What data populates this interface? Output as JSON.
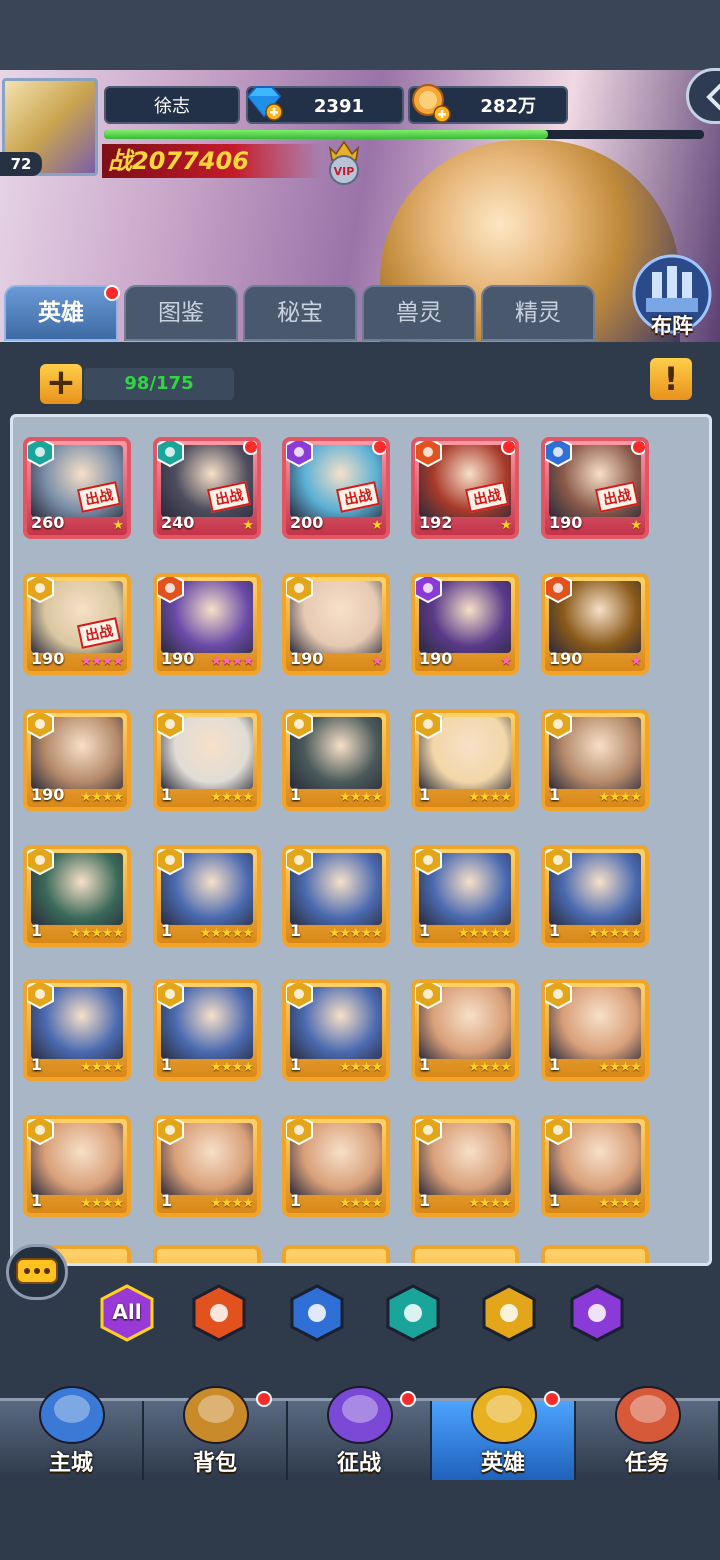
{
  "header": {
    "player_level": "72",
    "player_name": "徐志",
    "gems": "2391",
    "gold": "282万",
    "power": "2077406",
    "power_prefix": "战",
    "vip_label": "VIP",
    "exp_fraction": 0.74
  },
  "tabs": [
    {
      "label": "英雄",
      "active": true,
      "dot": true
    },
    {
      "label": "图鉴",
      "active": false,
      "dot": false
    },
    {
      "label": "秘宝",
      "active": false,
      "dot": false
    },
    {
      "label": "兽灵",
      "active": false,
      "dot": false
    },
    {
      "label": "精灵",
      "active": false,
      "dot": false
    }
  ],
  "formation_label": "布阵",
  "hero_count": "98/175",
  "warn_label": "!",
  "deploy_tag": "出战",
  "heroes": [
    {
      "level": "260",
      "stars": "★",
      "frame": "red",
      "faction": "skull",
      "tag": true,
      "dot": false,
      "portrait": "#7a8fa8"
    },
    {
      "level": "240",
      "stars": "★",
      "frame": "red",
      "faction": "skull",
      "tag": true,
      "dot": true,
      "portrait": "#4d4d5e"
    },
    {
      "level": "200",
      "stars": "★",
      "frame": "red",
      "faction": "trident",
      "tag": true,
      "dot": true,
      "portrait": "#5ab0d6"
    },
    {
      "level": "192",
      "stars": "★",
      "frame": "red",
      "faction": "flame",
      "tag": true,
      "dot": true,
      "portrait": "#a83a2a"
    },
    {
      "level": "190",
      "stars": "★",
      "frame": "red",
      "faction": "cross",
      "tag": true,
      "dot": true,
      "portrait": "#8a5a4a"
    },
    {
      "level": "190",
      "stars": "★★★★",
      "pink": true,
      "frame": "gold",
      "faction": "wing",
      "tag": true,
      "dot": false,
      "portrait": "#d9c7a0"
    },
    {
      "level": "190",
      "stars": "★★★★",
      "pink": true,
      "frame": "gold",
      "faction": "flame",
      "tag": false,
      "dot": false,
      "portrait": "#6a4aa8"
    },
    {
      "level": "190",
      "stars": "★",
      "pink": true,
      "frame": "gold",
      "faction": "wing",
      "tag": false,
      "dot": false,
      "portrait": "#e6c9b3"
    },
    {
      "level": "190",
      "stars": "★",
      "pink": true,
      "frame": "gold",
      "faction": "trident",
      "tag": false,
      "dot": false,
      "portrait": "#5a3a8a"
    },
    {
      "level": "190",
      "stars": "★",
      "pink": true,
      "frame": "gold",
      "faction": "flame",
      "tag": false,
      "dot": false,
      "portrait": "#8a5a1a"
    },
    {
      "level": "190",
      "stars": "★★★★",
      "frame": "gold",
      "faction": "wing",
      "tag": false,
      "dot": false,
      "portrait": "#b58a6a"
    },
    {
      "level": "1",
      "stars": "★★★★",
      "frame": "gold",
      "faction": "wing",
      "tag": false,
      "dot": false,
      "portrait": "#e0dcd6"
    },
    {
      "level": "1",
      "stars": "★★★★",
      "frame": "gold",
      "faction": "wing",
      "tag": false,
      "dot": false,
      "portrait": "#4a5a5a"
    },
    {
      "level": "1",
      "stars": "★★★★",
      "frame": "gold",
      "faction": "wing",
      "tag": false,
      "dot": false,
      "portrait": "#f2d7a8"
    },
    {
      "level": "1",
      "stars": "★★★★",
      "frame": "gold",
      "faction": "wing",
      "tag": false,
      "dot": false,
      "portrait": "#b58a6a"
    },
    {
      "level": "1",
      "stars": "★★★★★",
      "frame": "gold",
      "faction": "wing",
      "tag": false,
      "dot": false,
      "portrait": "#3a6a5a"
    },
    {
      "level": "1",
      "stars": "★★★★★",
      "frame": "gold",
      "faction": "wing",
      "tag": false,
      "dot": false,
      "portrait": "#4a6ab0"
    },
    {
      "level": "1",
      "stars": "★★★★★",
      "frame": "gold",
      "faction": "wing",
      "tag": false,
      "dot": false,
      "portrait": "#4a6ab0"
    },
    {
      "level": "1",
      "stars": "★★★★★",
      "frame": "gold",
      "faction": "wing",
      "tag": false,
      "dot": false,
      "portrait": "#4a6ab0"
    },
    {
      "level": "1",
      "stars": "★★★★★",
      "frame": "gold",
      "faction": "wing",
      "tag": false,
      "dot": false,
      "portrait": "#4a6ab0"
    },
    {
      "level": "1",
      "stars": "★★★★",
      "frame": "gold",
      "faction": "wing",
      "tag": false,
      "dot": false,
      "portrait": "#4a6ab0"
    },
    {
      "level": "1",
      "stars": "★★★★",
      "frame": "gold",
      "faction": "wing",
      "tag": false,
      "dot": false,
      "portrait": "#4a6ab0"
    },
    {
      "level": "1",
      "stars": "★★★★",
      "frame": "gold",
      "faction": "wing",
      "tag": false,
      "dot": false,
      "portrait": "#4a6ab0"
    },
    {
      "level": "1",
      "stars": "★★★★",
      "frame": "gold",
      "faction": "wing",
      "tag": false,
      "dot": false,
      "portrait": "#d9a07a"
    },
    {
      "level": "1",
      "stars": "★★★★",
      "frame": "gold",
      "faction": "wing",
      "tag": false,
      "dot": false,
      "portrait": "#d9a07a"
    },
    {
      "level": "1",
      "stars": "★★★★",
      "frame": "gold",
      "faction": "wing",
      "tag": false,
      "dot": false,
      "portrait": "#d9a07a"
    },
    {
      "level": "1",
      "stars": "★★★★",
      "frame": "gold",
      "faction": "wing",
      "tag": false,
      "dot": false,
      "portrait": "#d9a07a"
    },
    {
      "level": "1",
      "stars": "★★★★",
      "frame": "gold",
      "faction": "wing",
      "tag": false,
      "dot": false,
      "portrait": "#d9a07a"
    },
    {
      "level": "1",
      "stars": "★★★★",
      "frame": "gold",
      "faction": "wing",
      "tag": false,
      "dot": false,
      "portrait": "#d9a07a"
    },
    {
      "level": "1",
      "stars": "★★★★",
      "frame": "gold",
      "faction": "wing",
      "tag": false,
      "dot": false,
      "portrait": "#d9a07a"
    }
  ],
  "filters": [
    {
      "name": "all-filter",
      "label": "All",
      "color": "#9a3ad6"
    },
    {
      "name": "flame-filter",
      "label": "",
      "color": "#e2521e"
    },
    {
      "name": "cross-filter",
      "label": "",
      "color": "#2f6fd6"
    },
    {
      "name": "skull-filter",
      "label": "",
      "color": "#1aa59a"
    },
    {
      "name": "wing-filter",
      "label": "",
      "color": "#e3a51a"
    },
    {
      "name": "trident-filter",
      "label": "",
      "color": "#8a3ad6"
    }
  ],
  "nav": [
    {
      "label": "主城",
      "active": false,
      "dot": false,
      "icon": "castle-icon",
      "color": "#3a7ad6"
    },
    {
      "label": "背包",
      "active": false,
      "dot": true,
      "icon": "chest-icon",
      "color": "#c98a2a"
    },
    {
      "label": "征战",
      "active": false,
      "dot": true,
      "icon": "dragon-portal-icon",
      "color": "#7a4ad6"
    },
    {
      "label": "英雄",
      "active": true,
      "dot": true,
      "icon": "helmet-icon",
      "color": "#e6b020"
    },
    {
      "label": "任务",
      "active": false,
      "dot": false,
      "icon": "scroll-icon",
      "color": "#d65a3a"
    }
  ]
}
